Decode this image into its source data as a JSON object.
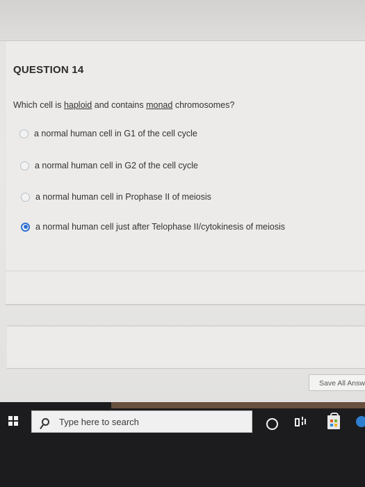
{
  "question": {
    "title": "QUESTION 14",
    "text_before_haploid": "Which cell is ",
    "haploid": "haploid",
    "text_between": " and contains ",
    "monad": "monad",
    "text_after": " chromosomes?",
    "options": [
      {
        "label": "a normal human cell in G1 of the cell cycle",
        "selected": false
      },
      {
        "label": "a normal human cell in G2 of the cell cycle",
        "selected": false
      },
      {
        "label": "a normal human cell in Prophase II of meiosis",
        "selected": false
      },
      {
        "label": "a normal human cell just after Telophase II/cytokinesis of meiosis",
        "selected": true
      }
    ]
  },
  "footer": {
    "save_label": "Save All Answ"
  },
  "taskbar": {
    "search_placeholder": "Type here to search",
    "icons": [
      "windows-start-icon",
      "search-icon",
      "cortana-icon",
      "task-view-icon",
      "store-icon",
      "edge-icon"
    ]
  },
  "colors": {
    "radio_selected": "#2d6fcf",
    "taskbar": "#1c1c1e"
  }
}
